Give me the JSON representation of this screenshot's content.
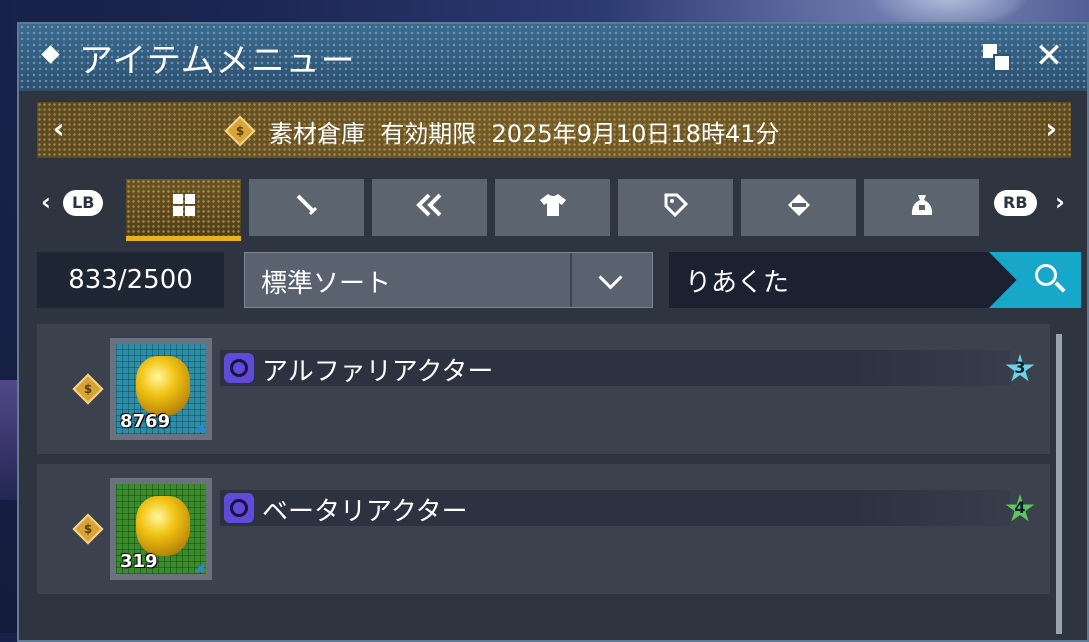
{
  "window": {
    "title": "アイテムメニュー"
  },
  "storage": {
    "text": "素材倉庫  有効期限  2025年9月10日18時41分",
    "coin_letter": "$"
  },
  "tabs": {
    "left_shoulder": "LB",
    "right_shoulder": "RB",
    "items": [
      {
        "icon": "grid-icon",
        "active": true
      },
      {
        "icon": "sword-icon",
        "active": false
      },
      {
        "icon": "ammo-icon",
        "active": false
      },
      {
        "icon": "shirt-icon",
        "active": false
      },
      {
        "icon": "tag-icon",
        "active": false
      },
      {
        "icon": "tool-icon",
        "active": false
      },
      {
        "icon": "bag-icon",
        "active": false
      }
    ]
  },
  "inventory": {
    "count": "833/2500"
  },
  "sort": {
    "label": "標準ソート"
  },
  "search": {
    "value": "りあくた"
  },
  "items": [
    {
      "name": "アルファリアクター",
      "quantity": "8769",
      "rarity": "3",
      "coin_letter": "$"
    },
    {
      "name": "ベータリアクター",
      "quantity": "319",
      "rarity": "4",
      "coin_letter": "$"
    }
  ],
  "colors": {
    "accent": "#e9b320",
    "search": "#16a7c9",
    "category": "#5f4bd8"
  }
}
